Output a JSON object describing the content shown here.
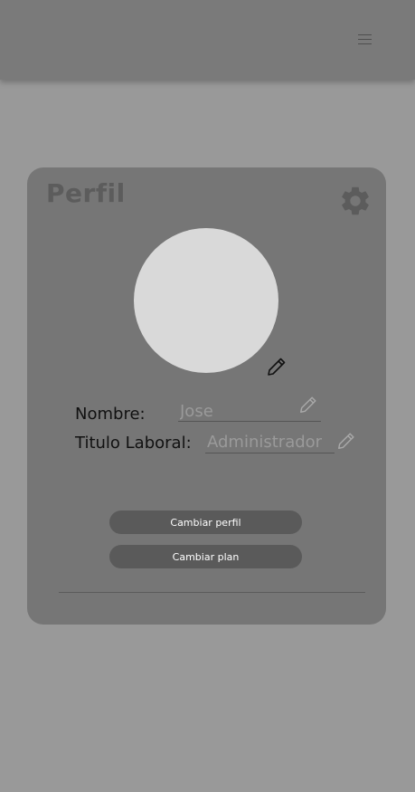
{
  "header": {
    "menu_icon": "hamburger-menu-icon"
  },
  "profile_card": {
    "title": "Perfil",
    "settings_icon": "gear-icon",
    "avatar_edit_icon": "pencil-icon",
    "fields": {
      "nombre": {
        "label": "Nombre:",
        "value": "Jose"
      },
      "titulo": {
        "label": "Titulo Laboral:",
        "value": "Administrador"
      }
    },
    "buttons": {
      "change_profile": "Cambiar perfil",
      "change_plan": "Cambiar plan"
    }
  },
  "colors": {
    "background": "#999999",
    "header": "#7a7a7a",
    "card": "#767676",
    "avatar": "#d9d9d9",
    "button": "#5a5a5a"
  }
}
